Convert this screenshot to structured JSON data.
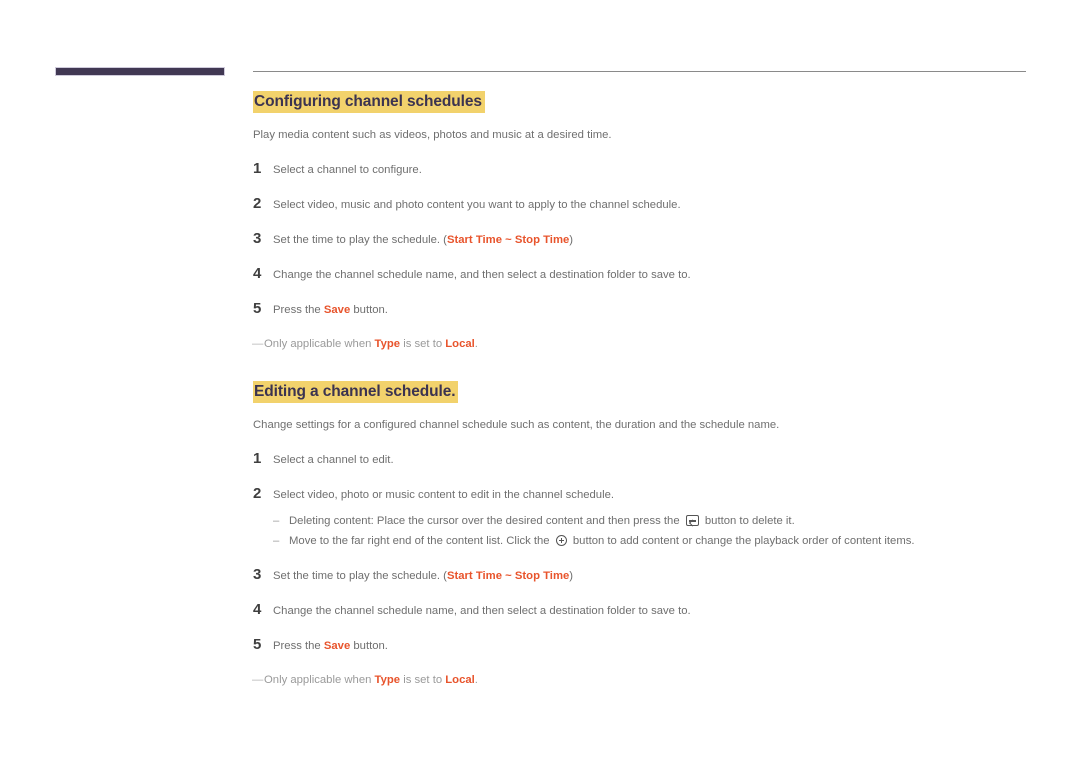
{
  "page": {
    "background_color": "#ffffff",
    "accent_highlight_color": "#f2d26c",
    "heading_text_color": "#3b3350",
    "keyword_color": "#e8542c",
    "body_text_color": "#6f6f6f",
    "header_bar_color": "#413853",
    "header_rule_color": "#8a8a8a"
  },
  "sections": [
    {
      "heading": "Configuring channel schedules",
      "intro": "Play media content such as videos, photos and music at a desired time.",
      "steps": [
        {
          "number": "1",
          "parts": [
            {
              "type": "text",
              "value": "Select a channel to configure."
            }
          ]
        },
        {
          "number": "2",
          "parts": [
            {
              "type": "text",
              "value": "Select video, music and photo content you want to apply to the channel schedule."
            }
          ]
        },
        {
          "number": "3",
          "parts": [
            {
              "type": "text",
              "value": "Set the time to play the schedule. ("
            },
            {
              "type": "keyword",
              "value": "Start Time"
            },
            {
              "type": "keyword",
              "value": " ~ "
            },
            {
              "type": "keyword",
              "value": "Stop Time"
            },
            {
              "type": "text",
              "value": ")"
            }
          ]
        },
        {
          "number": "4",
          "parts": [
            {
              "type": "text",
              "value": "Change the channel schedule name, and then select a destination folder to save to."
            }
          ]
        },
        {
          "number": "5",
          "parts": [
            {
              "type": "text",
              "value": "Press the "
            },
            {
              "type": "keyword",
              "value": "Save"
            },
            {
              "type": "text",
              "value": " button."
            }
          ]
        }
      ],
      "note": {
        "dash": "—",
        "parts": [
          {
            "type": "text",
            "value": "Only applicable when "
          },
          {
            "type": "keyword",
            "value": "Type"
          },
          {
            "type": "text",
            "value": " is set to "
          },
          {
            "type": "keyword",
            "value": "Local"
          },
          {
            "type": "text",
            "value": "."
          }
        ]
      }
    },
    {
      "heading": "Editing a channel schedule.",
      "intro": "Change settings for a configured channel schedule such as content, the duration and the schedule name.",
      "steps": [
        {
          "number": "1",
          "parts": [
            {
              "type": "text",
              "value": "Select a channel to edit."
            }
          ]
        },
        {
          "number": "2",
          "parts": [
            {
              "type": "text",
              "value": "Select video, photo or music content to edit in the channel schedule."
            }
          ],
          "subs": [
            {
              "dash": "–",
              "parts": [
                {
                  "type": "text",
                  "value": "Deleting content: Place the cursor over the desired content and then press the "
                },
                {
                  "type": "icon",
                  "value": "enter-key-icon"
                },
                {
                  "type": "text",
                  "value": " button to delete it."
                }
              ]
            },
            {
              "dash": "–",
              "parts": [
                {
                  "type": "text",
                  "value": "Move to the far right end of the content list. Click the "
                },
                {
                  "type": "icon",
                  "value": "plus-circle-icon"
                },
                {
                  "type": "text",
                  "value": " button to add content or change the playback order of content items."
                }
              ]
            }
          ]
        },
        {
          "number": "3",
          "parts": [
            {
              "type": "text",
              "value": "Set the time to play the schedule. ("
            },
            {
              "type": "keyword",
              "value": "Start Time"
            },
            {
              "type": "keyword",
              "value": " ~ "
            },
            {
              "type": "keyword",
              "value": "Stop Time"
            },
            {
              "type": "text",
              "value": ")"
            }
          ]
        },
        {
          "number": "4",
          "parts": [
            {
              "type": "text",
              "value": "Change the channel schedule name, and then select a destination folder to save to."
            }
          ]
        },
        {
          "number": "5",
          "parts": [
            {
              "type": "text",
              "value": "Press the "
            },
            {
              "type": "keyword",
              "value": "Save"
            },
            {
              "type": "text",
              "value": " button."
            }
          ]
        }
      ],
      "note": {
        "dash": "—",
        "parts": [
          {
            "type": "text",
            "value": "Only applicable when "
          },
          {
            "type": "keyword",
            "value": "Type"
          },
          {
            "type": "text",
            "value": " is set to "
          },
          {
            "type": "keyword",
            "value": "Local"
          },
          {
            "type": "text",
            "value": "."
          }
        ]
      }
    }
  ]
}
